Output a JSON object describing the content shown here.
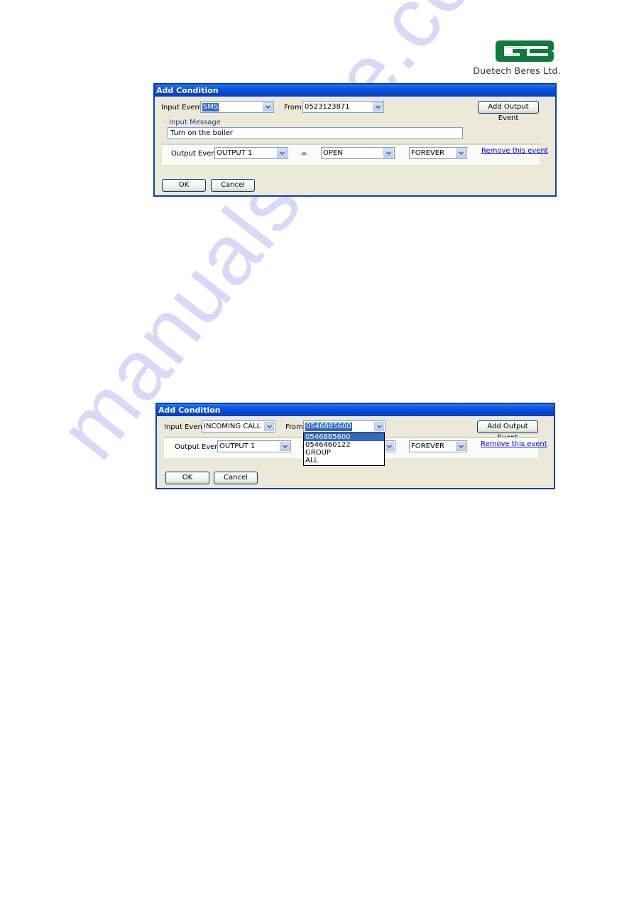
{
  "logo": {
    "company": "Duetech Beres Ltd.",
    "brand_color": "#0f7a3c"
  },
  "watermark": {
    "text": "manualshive.com"
  },
  "dialogs": [
    {
      "title": "Add Condition",
      "input_event_label": "Input Event",
      "input_event_value": "SMS",
      "from_label": "From",
      "from_value": "0523123871",
      "add_output_event_label": "Add Output Event",
      "input_message_label": "Input Message",
      "input_message_value": "Turn on the boiler",
      "output_event_label": "Output Event",
      "output_value": "OUTPUT 1",
      "equals": "=",
      "state_value": "OPEN",
      "duration_value": "FOREVER",
      "remove_link": "Remove this event",
      "ok_label": "OK",
      "cancel_label": "Cancel"
    },
    {
      "title": "Add Condition",
      "input_event_label": "Input Event",
      "input_event_value": "INCOMING CALL",
      "from_label": "From",
      "from_value": "0546885600",
      "from_options": [
        "0546885600",
        "0546460122",
        "GROUP",
        "ALL"
      ],
      "from_highlighted_index": 0,
      "add_output_event_label": "Add Output Event",
      "output_event_label": "Output Event",
      "output_value": "OUTPUT 1",
      "equals": "=",
      "duration_value": "FOREVER",
      "remove_link": "Remove this event",
      "ok_label": "OK",
      "cancel_label": "Cancel"
    }
  ]
}
